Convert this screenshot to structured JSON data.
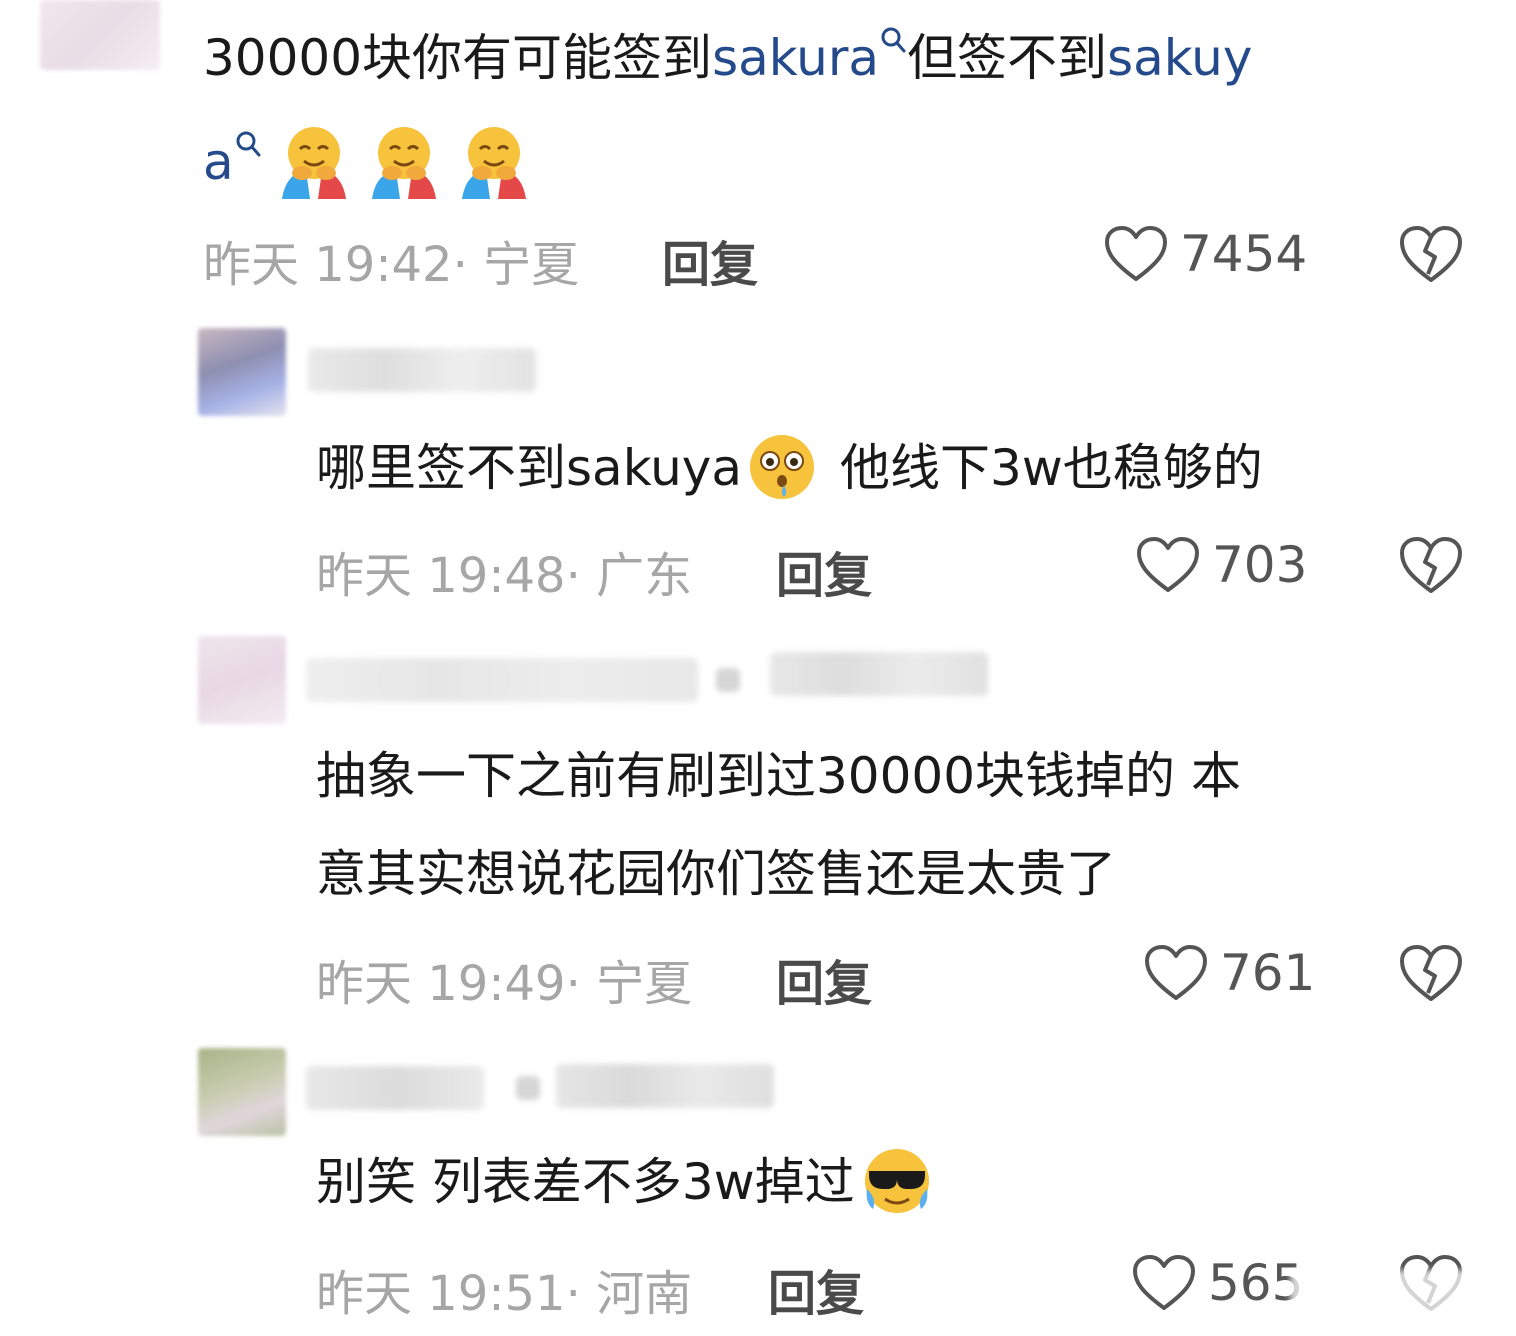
{
  "comments": [
    {
      "text_a": "30000块你有可能签到",
      "link_1": "sakura",
      "text_b": "但签不到",
      "link_2a": "sakuy",
      "link_2b": "a",
      "time": "昨天 19:42",
      "location": "宁夏",
      "reply_label": "回复",
      "likes": "7454"
    },
    {
      "text": "哪里签不到sakuya",
      "text_after": "他线下3w也稳够的",
      "time": "昨天 19:48",
      "location": "广东",
      "reply_label": "回复",
      "likes": "703"
    },
    {
      "line1": "抽象一下之前有刷到过30000块钱掉的 本",
      "line2": "意其实想说花园你们签售还是太贵了",
      "time": "昨天 19:49",
      "location": "宁夏",
      "reply_label": "回复",
      "likes": "761"
    },
    {
      "text": "别笑 列表差不多3w掉过",
      "time": "昨天 19:51",
      "location": "河南",
      "reply_label": "回复",
      "likes": "565"
    }
  ],
  "colors": {
    "link": "#254a8c",
    "meta": "#a6a6a6",
    "reply": "#4a4a4a",
    "text": "#1a1a1a"
  },
  "icons": [
    "search-icon",
    "hug-emoji",
    "flushed-emoji",
    "cool-crying-emoji",
    "heart-icon",
    "broken-heart-icon"
  ]
}
